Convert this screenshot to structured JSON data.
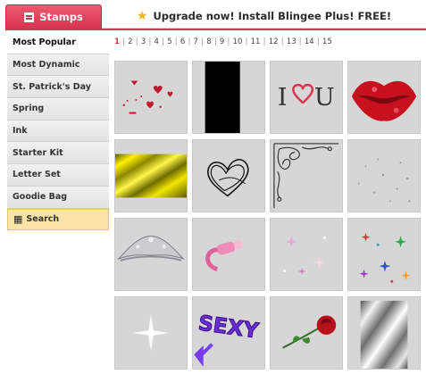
{
  "header": {
    "tab_label": "Stamps",
    "upgrade_text": "Upgrade now! Install Blingee Plus! FREE!",
    "accent_color": "#d7344f"
  },
  "sidebar": {
    "items": [
      {
        "label": "Most Popular"
      },
      {
        "label": "Most Dynamic"
      },
      {
        "label": "St. Patrick's Day"
      },
      {
        "label": "Spring"
      },
      {
        "label": "Ink"
      },
      {
        "label": "Starter Kit"
      },
      {
        "label": "Letter Set"
      },
      {
        "label": "Goodie Bag"
      },
      {
        "label": "Search"
      }
    ],
    "active_index": 0
  },
  "pagination": {
    "pages": [
      "1",
      "2",
      "3",
      "4",
      "5",
      "6",
      "7",
      "8",
      "9",
      "10",
      "11",
      "12",
      "13",
      "14",
      "15"
    ],
    "current": "1"
  },
  "stamps": [
    {
      "name": "hearts-scatter-stamp"
    },
    {
      "name": "black-rectangle-stamp"
    },
    {
      "name": "i-love-u-stamp",
      "text_i": "I",
      "text_u": "U"
    },
    {
      "name": "red-lips-stamp"
    },
    {
      "name": "yellow-stripes-stamp"
    },
    {
      "name": "scribble-heart-stamp"
    },
    {
      "name": "ornate-corner-stamp"
    },
    {
      "name": "silver-sparkles-stamp"
    },
    {
      "name": "tiara-stamp"
    },
    {
      "name": "pink-pacifier-stamp"
    },
    {
      "name": "pink-sparkles-stamp"
    },
    {
      "name": "colorful-stars-stamp"
    },
    {
      "name": "white-glitter-stamp"
    },
    {
      "name": "sexy-text-stamp",
      "text": "SEXY"
    },
    {
      "name": "rose-stamp"
    },
    {
      "name": "silver-stripes-stamp"
    }
  ]
}
